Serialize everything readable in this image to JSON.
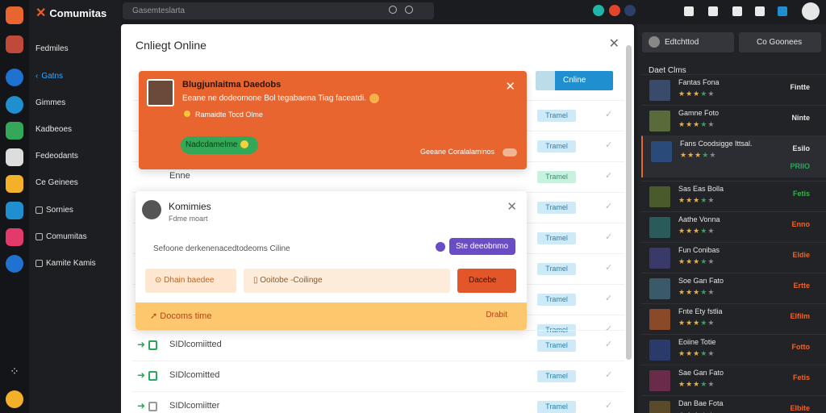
{
  "app": {
    "brand": "Comumitas"
  },
  "sidebar": {
    "items": [
      {
        "label": "Fedmiles",
        "active": false
      },
      {
        "label": "Gatns",
        "active": true
      },
      {
        "label": "Gimmes",
        "active": false
      },
      {
        "label": "Kadbeoes",
        "active": false
      },
      {
        "label": "Fedeodants",
        "active": false
      },
      {
        "label": "Ce Geinees",
        "active": false
      },
      {
        "label": "Sornies",
        "active": false
      },
      {
        "label": "Comumitas",
        "active": false
      },
      {
        "label": "Kamite Kamis",
        "active": false
      }
    ]
  },
  "search": {
    "placeholder": "Gasemteslarta"
  },
  "main": {
    "title": "Cnliegt Online",
    "online_button": "Cnline",
    "rows": [
      {
        "badge": "Tramel",
        "badge_color": "blue"
      },
      {
        "badge": "Tramel",
        "badge_color": "blue"
      },
      {
        "text": "Enne",
        "badge": "Tramel",
        "badge_color": "green"
      },
      {
        "badge": "Tramel",
        "badge_color": "blue"
      },
      {
        "badge": "Tramel",
        "badge_color": "blue"
      },
      {
        "badge": "Tramel",
        "badge_color": "blue"
      },
      {
        "badge": "Tramel",
        "badge_color": "blue"
      },
      {
        "badge": "Tramel",
        "badge_color": "blue"
      },
      {
        "text": "SIDlcomiitted",
        "badge": "Tramel",
        "badge_color": "blue",
        "box": "green"
      },
      {
        "text": "SIDlcomitted",
        "badge": "Tramel",
        "badge_color": "blue",
        "box": "green"
      },
      {
        "text": "SIDlcomiitter",
        "badge": "Tramel",
        "badge_color": "blue",
        "box": "gray"
      }
    ]
  },
  "notification": {
    "title": "Blugjunlaitma Daedobs",
    "body": "Eeane ne dodeomone Bol tegabaena Tiag faceatdi.",
    "sub": "Ramaidte Tocd Olme",
    "accept": "Nadcdamelme",
    "more": "Geeane Coralalaminos"
  },
  "popup": {
    "name": "Komimies",
    "status": "Fdme moart",
    "message": "Sefoone derkenenacedtodeoms Ciline",
    "send": "Ste deeobnmo",
    "btn_left": "Dhain baedee",
    "btn_mid": "Ooitobe -Coilinge",
    "btn_right": "Dacebe",
    "bar_left": "Docoms time",
    "bar_right": "Drabit"
  },
  "right": {
    "tab1": "Edtchttod",
    "tab2": "Co Goonees",
    "section": "Daet Clms",
    "games": [
      {
        "name": "Fantas Fona",
        "stars": "★★★★★",
        "status": "Fintte",
        "status_color": "#e6e6e6",
        "avatar": "#3a4a6a"
      },
      {
        "name": "Gamne Foto",
        "stars": "★★★★★",
        "status": "Ninte",
        "status_color": "#e6e6e6",
        "avatar": "#5a6a3a"
      },
      {
        "name": "Fans Coodsigge Ittsal.",
        "stars": "★★★★★",
        "status": "Esilo",
        "status_color": "#e6e6e6",
        "avatar": "#2a4a7a",
        "highlight": true,
        "extra": "PRIIO"
      },
      {
        "name": "Sas Eas Bolla",
        "stars": "★★★★★",
        "status": "Fetis",
        "status_color": "#37b24d",
        "avatar": "#4a5a2a"
      },
      {
        "name": "Aathe Vonna",
        "stars": "★★★★★",
        "status": "Enno",
        "status_color": "#e8652f",
        "avatar": "#2a5a5a"
      },
      {
        "name": "Fun Conibas",
        "stars": "★★★★★",
        "status": "Eldie",
        "status_color": "#e8652f",
        "avatar": "#3a3a6a"
      },
      {
        "name": "Soe Gan Fato",
        "stars": "★★★★★",
        "status": "Ertte",
        "status_color": "#e8652f",
        "avatar": "#3a5a6a"
      },
      {
        "name": "Fnte Ety fstlia",
        "stars": "★★★★★",
        "status": "Elfilm",
        "status_color": "#e8652f",
        "avatar": "#8a4a2a"
      },
      {
        "name": "Eoiine Totie",
        "stars": "★★★★★",
        "status": "Fotto",
        "status_color": "#e8652f",
        "avatar": "#2a3a6a"
      },
      {
        "name": "Sae Gan Fato",
        "stars": "★★★★★",
        "status": "Fetis",
        "status_color": "#e8652f",
        "avatar": "#6a2a4a"
      },
      {
        "name": "Dan Bae Fota",
        "stars": "★★★★★",
        "status": "Elbite",
        "status_color": "#e8652f",
        "avatar": "#5a4a2a"
      }
    ]
  },
  "colors": {
    "accent": "#e8652f",
    "blue": "#1f8fd0",
    "green": "#33a858",
    "purple": "#6a4cc4"
  }
}
